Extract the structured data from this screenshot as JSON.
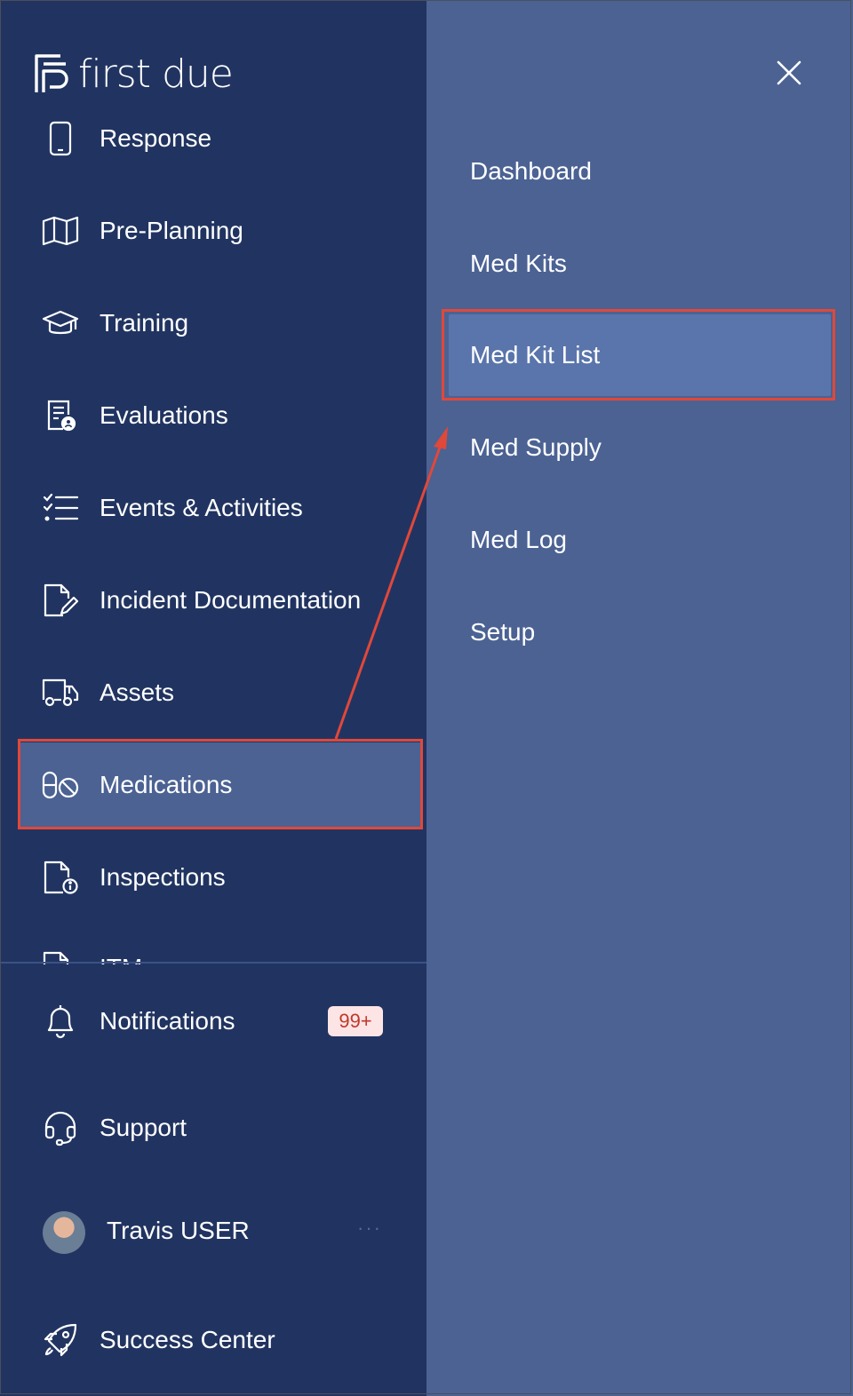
{
  "brand": {
    "name": "first due"
  },
  "sidebar": {
    "items": [
      {
        "label": "Response",
        "icon": "phone-icon"
      },
      {
        "label": "Pre-Planning",
        "icon": "map-icon"
      },
      {
        "label": "Training",
        "icon": "graduation-cap-icon"
      },
      {
        "label": "Evaluations",
        "icon": "evaluation-form-icon"
      },
      {
        "label": "Events & Activities",
        "icon": "checklist-icon"
      },
      {
        "label": "Incident Documentation",
        "icon": "document-edit-icon"
      },
      {
        "label": "Assets",
        "icon": "truck-icon"
      },
      {
        "label": "Medications",
        "icon": "pill-icon",
        "active": true
      },
      {
        "label": "Inspections",
        "icon": "document-info-icon"
      },
      {
        "label": "ITM",
        "icon": "document-icon"
      }
    ],
    "bottom": {
      "notifications": {
        "label": "Notifications",
        "badge": "99+",
        "icon": "bell-icon"
      },
      "support": {
        "label": "Support",
        "icon": "headset-icon"
      },
      "user": {
        "name": "Travis USER",
        "more": "···"
      },
      "success_center": {
        "label": "Success Center",
        "icon": "rocket-icon"
      }
    }
  },
  "submenu": {
    "close_icon": "close-icon",
    "items": [
      {
        "label": "Dashboard"
      },
      {
        "label": "Med Kits"
      },
      {
        "label": "Med Kit List",
        "active": true
      },
      {
        "label": "Med Supply"
      },
      {
        "label": "Med Log"
      },
      {
        "label": "Setup"
      }
    ]
  },
  "colors": {
    "sidebar_bg": "#213461",
    "submenu_bg": "#4b6293",
    "active_bg": "#5a75ab",
    "highlight": "#e0483a",
    "badge_bg": "#fde5e5",
    "badge_text": "#c0392b"
  }
}
